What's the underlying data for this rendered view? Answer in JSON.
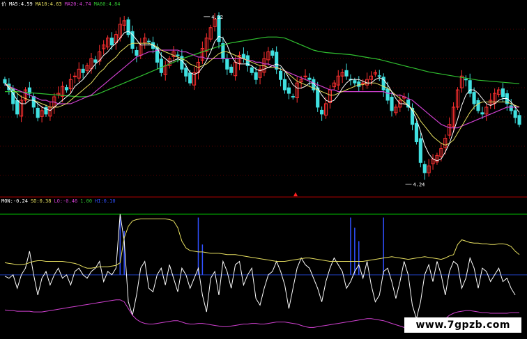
{
  "chart_data": [
    {
      "type": "candlestick",
      "legend": [
        {
          "text": "价",
          "color": "#ffffff"
        },
        {
          "text": "MA5:4.59",
          "color": "#ffffff"
        },
        {
          "text": "MA10:4.63",
          "color": "#e8e060"
        },
        {
          "text": "MA20:4.74",
          "color": "#d040d0"
        },
        {
          "text": "MA60:4.84",
          "color": "#30c030"
        }
      ],
      "price_range": [
        4.0,
        9.4
      ],
      "annotations": [
        {
          "text": "4.32",
          "price": 9.12,
          "bar": 50
        },
        {
          "text": "4.24",
          "price": 4.27,
          "bar": 99
        }
      ],
      "close": [
        7.2,
        7.0,
        6.6,
        6.3,
        6.7,
        7.0,
        6.9,
        6.5,
        6.2,
        6.4,
        6.3,
        6.5,
        6.8,
        6.9,
        7.1,
        7.0,
        7.3,
        7.4,
        7.6,
        7.5,
        7.7,
        7.9,
        7.8,
        8.1,
        8.3,
        8.5,
        8.3,
        8.6,
        8.9,
        9.0,
        8.6,
        8.2,
        8.0,
        8.3,
        8.5,
        8.4,
        8.2,
        7.8,
        7.5,
        7.7,
        7.9,
        8.1,
        8.0,
        7.6,
        7.4,
        7.2,
        7.5,
        7.8,
        8.2,
        8.5,
        8.8,
        9.05,
        8.4,
        7.9,
        7.6,
        7.5,
        7.8,
        8.0,
        7.9,
        7.7,
        7.5,
        7.3,
        7.6,
        7.9,
        8.1,
        8.0,
        7.6,
        7.3,
        7.0,
        6.9,
        6.8,
        7.2,
        7.3,
        7.4,
        7.3,
        7.0,
        6.5,
        6.3,
        6.6,
        7.0,
        7.2,
        7.4,
        7.5,
        7.4,
        7.3,
        7.2,
        7.1,
        7.2,
        7.3,
        7.4,
        7.5,
        7.4,
        7.0,
        6.7,
        6.4,
        6.5,
        6.7,
        6.8,
        6.5,
        6.0,
        5.5,
        4.9,
        4.6,
        4.8,
        5.0,
        5.1,
        5.3,
        5.6,
        6.0,
        6.5,
        7.0,
        7.4,
        7.3,
        6.9,
        6.6,
        6.4,
        6.3,
        6.5,
        6.7,
        6.9,
        7.0,
        6.8,
        6.6,
        6.4,
        6.2,
        6.0
      ],
      "ma5": [
        7.2,
        7.05,
        6.9,
        6.7,
        6.6,
        6.6,
        6.7,
        6.7,
        6.6,
        6.5,
        6.45,
        6.4,
        6.5,
        6.6,
        6.7,
        6.8,
        6.9,
        7.1,
        7.2,
        7.3,
        7.45,
        7.6,
        7.75,
        7.85,
        8.0,
        8.1,
        8.25,
        8.35,
        8.5,
        8.65,
        8.7,
        8.6,
        8.45,
        8.3,
        8.3,
        8.3,
        8.3,
        8.2,
        8.0,
        7.9,
        7.8,
        7.85,
        7.9,
        7.85,
        7.7,
        7.5,
        7.45,
        7.5,
        7.65,
        7.85,
        8.1,
        8.4,
        8.55,
        8.5,
        8.3,
        8.0,
        7.8,
        7.75,
        7.75,
        7.75,
        7.7,
        7.6,
        7.55,
        7.6,
        7.65,
        7.7,
        7.75,
        7.7,
        7.55,
        7.35,
        7.15,
        7.05,
        7.05,
        7.1,
        7.2,
        7.2,
        7.05,
        6.85,
        6.7,
        6.65,
        6.7,
        6.85,
        7.05,
        7.2,
        7.3,
        7.3,
        7.3,
        7.25,
        7.2,
        7.2,
        7.3,
        7.35,
        7.3,
        7.15,
        6.95,
        6.75,
        6.6,
        6.6,
        6.55,
        6.4,
        6.15,
        5.8,
        5.4,
        5.15,
        5.0,
        4.95,
        5.0,
        5.2,
        5.45,
        5.8,
        6.15,
        6.55,
        6.85,
        7.0,
        7.0,
        6.9,
        6.75,
        6.6,
        6.55,
        6.6,
        6.7,
        6.75,
        6.75,
        6.65,
        6.5,
        6.35
      ],
      "ma10": [
        7.2,
        7.1,
        7.0,
        6.9,
        6.8,
        6.75,
        6.7,
        6.7,
        6.65,
        6.6,
        6.55,
        6.5,
        6.5,
        6.5,
        6.55,
        6.6,
        6.7,
        6.8,
        6.9,
        7.0,
        7.1,
        7.2,
        7.35,
        7.5,
        7.6,
        7.75,
        7.85,
        7.95,
        8.1,
        8.2,
        8.3,
        8.35,
        8.35,
        8.35,
        8.35,
        8.35,
        8.3,
        8.25,
        8.15,
        8.1,
        8.05,
        8.0,
        7.95,
        7.9,
        7.85,
        7.75,
        7.7,
        7.65,
        7.7,
        7.75,
        7.85,
        7.95,
        8.05,
        8.1,
        8.1,
        8.05,
        8.0,
        7.95,
        7.9,
        7.85,
        7.8,
        7.75,
        7.7,
        7.7,
        7.65,
        7.65,
        7.65,
        7.6,
        7.55,
        7.45,
        7.35,
        7.25,
        7.2,
        7.15,
        7.1,
        7.05,
        7.0,
        6.95,
        6.9,
        6.85,
        6.85,
        6.9,
        6.95,
        7.0,
        7.05,
        7.1,
        7.15,
        7.15,
        7.2,
        7.2,
        7.2,
        7.15,
        7.1,
        7.05,
        6.95,
        6.85,
        6.75,
        6.65,
        6.55,
        6.45,
        6.3,
        6.1,
        5.95,
        5.8,
        5.65,
        5.55,
        5.45,
        5.4,
        5.45,
        5.55,
        5.75,
        5.95,
        6.15,
        6.35,
        6.5,
        6.6,
        6.65,
        6.65,
        6.65,
        6.65,
        6.65,
        6.65,
        6.65,
        6.6,
        6.55,
        6.5
      ],
      "ma20": [
        7.15,
        7.1,
        7.05,
        7.0,
        6.95,
        6.9,
        6.85,
        6.8,
        6.75,
        6.7,
        6.7,
        6.65,
        6.65,
        6.6,
        6.6,
        6.6,
        6.6,
        6.65,
        6.7,
        6.75,
        6.8,
        6.85,
        6.95,
        7.05,
        7.15,
        7.25,
        7.35,
        7.45,
        7.55,
        7.65,
        7.75,
        7.85,
        7.95,
        8.0,
        8.05,
        8.1,
        8.1,
        8.15,
        8.15,
        8.15,
        8.15,
        8.15,
        8.15,
        8.1,
        8.1,
        8.05,
        8.0,
        7.95,
        7.95,
        7.9,
        7.9,
        7.9,
        7.9,
        7.9,
        7.9,
        7.9,
        7.9,
        7.9,
        7.9,
        7.85,
        7.85,
        7.8,
        7.8,
        7.75,
        7.75,
        7.7,
        7.65,
        7.6,
        7.55,
        7.5,
        7.45,
        7.4,
        7.35,
        7.3,
        7.25,
        7.2,
        7.15,
        7.1,
        7.05,
        7.0,
        7.0,
        6.95,
        6.95,
        6.95,
        6.95,
        6.95,
        6.95,
        6.95,
        6.95,
        6.95,
        6.95,
        6.95,
        6.95,
        6.9,
        6.9,
        6.85,
        6.85,
        6.8,
        6.75,
        6.7,
        6.6,
        6.5,
        6.4,
        6.3,
        6.2,
        6.1,
        6.0,
        5.95,
        5.9,
        5.9,
        5.9,
        5.95,
        6.0,
        6.05,
        6.1,
        6.15,
        6.2,
        6.25,
        6.3,
        6.35,
        6.4,
        6.45,
        6.5,
        6.5,
        6.5,
        6.5
      ],
      "ma60": [
        6.95,
        6.95,
        6.95,
        6.95,
        6.94,
        6.93,
        6.92,
        6.91,
        6.9,
        6.89,
        6.88,
        6.87,
        6.86,
        6.85,
        6.84,
        6.83,
        6.82,
        6.81,
        6.8,
        6.8,
        6.81,
        6.83,
        6.86,
        6.9,
        6.95,
        7.0,
        7.05,
        7.1,
        7.15,
        7.2,
        7.25,
        7.3,
        7.35,
        7.4,
        7.45,
        7.5,
        7.55,
        7.6,
        7.65,
        7.7,
        7.75,
        7.8,
        7.85,
        7.9,
        7.94,
        7.98,
        8.02,
        8.06,
        8.1,
        8.14,
        8.18,
        8.22,
        8.26,
        8.3,
        8.33,
        8.36,
        8.38,
        8.4,
        8.42,
        8.44,
        8.46,
        8.48,
        8.5,
        8.52,
        8.53,
        8.53,
        8.53,
        8.52,
        8.5,
        8.45,
        8.4,
        8.35,
        8.3,
        8.25,
        8.2,
        8.15,
        8.12,
        8.1,
        8.08,
        8.07,
        8.06,
        8.05,
        8.04,
        8.03,
        8.02,
        8.0,
        7.98,
        7.96,
        7.94,
        7.92,
        7.9,
        7.88,
        7.85,
        7.82,
        7.79,
        7.76,
        7.73,
        7.7,
        7.67,
        7.64,
        7.61,
        7.58,
        7.55,
        7.52,
        7.5,
        7.48,
        7.46,
        7.44,
        7.42,
        7.4,
        7.38,
        7.36,
        7.34,
        7.32,
        7.3,
        7.28,
        7.27,
        7.26,
        7.25,
        7.24,
        7.23,
        7.22,
        7.21,
        7.2,
        7.19,
        7.18
      ]
    },
    {
      "type": "line",
      "legend": [
        {
          "text": "MON:-0.24",
          "color": "#ffffff"
        },
        {
          "text": "SO:0.38",
          "color": "#e8e060"
        },
        {
          "text": "LO:-0.46",
          "color": "#d040d0"
        },
        {
          "text": "1.00",
          "color": "#30c030"
        },
        {
          "text": "HI:0.10",
          "color": "#3050ff"
        }
      ],
      "y_range": [
        -0.8,
        1.1
      ],
      "hline": 1.0,
      "hi_level": 0.1,
      "series": [
        {
          "key": "MON",
          "values": [
            0.08,
            0.05,
            0.1,
            -0.1,
            0.1,
            0.2,
            0.45,
            0.1,
            -0.2,
            0.05,
            0.15,
            -0.05,
            0.1,
            0.2,
            0.05,
            0.1,
            -0.05,
            0.15,
            0.2,
            0.1,
            0.05,
            0.15,
            0.2,
            0.3,
            0.0,
            0.15,
            0.1,
            0.2,
            1.0,
            0.6,
            -0.3,
            -0.5,
            -0.2,
            0.2,
            0.3,
            -0.1,
            -0.15,
            0.1,
            0.2,
            -0.05,
            0.25,
            0.05,
            -0.15,
            0.2,
            0.1,
            -0.1,
            0.05,
            0.2,
            -0.2,
            -0.45,
            0.05,
            0.15,
            -0.2,
            0.3,
            0.15,
            -0.1,
            0.25,
            0.3,
            -0.05,
            0.1,
            0.2,
            -0.25,
            -0.35,
            -0.1,
            0.1,
            0.15,
            0.3,
            0.15,
            -0.05,
            -0.4,
            -0.1,
            0.2,
            0.35,
            0.25,
            0.2,
            0.05,
            -0.1,
            -0.3,
            0.0,
            0.2,
            0.35,
            0.25,
            0.15,
            -0.1,
            0.0,
            0.15,
            0.25,
            0.05,
            0.3,
            -0.05,
            -0.3,
            -0.2,
            0.15,
            0.2,
            0.0,
            -0.25,
            0.0,
            0.3,
            0.1,
            -0.35,
            -0.55,
            -0.3,
            0.1,
            0.25,
            0.0,
            0.3,
            0.1,
            -0.2,
            0.15,
            0.3,
            0.25,
            -0.1,
            0.05,
            0.35,
            0.2,
            -0.1,
            0.2,
            0.15,
            0.0,
            0.1,
            0.2,
            0.0,
            0.05,
            -0.1,
            -0.2
          ]
        },
        {
          "key": "SO",
          "values": [
            0.28,
            0.27,
            0.26,
            0.25,
            0.25,
            0.26,
            0.28,
            0.3,
            0.31,
            0.31,
            0.3,
            0.3,
            0.3,
            0.3,
            0.3,
            0.29,
            0.28,
            0.27,
            0.25,
            0.22,
            0.2,
            0.2,
            0.21,
            0.22,
            0.22,
            0.22,
            0.23,
            0.24,
            0.28,
            0.65,
            0.82,
            0.9,
            0.92,
            0.93,
            0.93,
            0.93,
            0.93,
            0.93,
            0.93,
            0.93,
            0.92,
            0.9,
            0.8,
            0.6,
            0.5,
            0.46,
            0.45,
            0.44,
            0.44,
            0.43,
            0.42,
            0.42,
            0.42,
            0.41,
            0.4,
            0.4,
            0.4,
            0.39,
            0.38,
            0.37,
            0.36,
            0.35,
            0.34,
            0.33,
            0.32,
            0.31,
            0.3,
            0.3,
            0.3,
            0.31,
            0.32,
            0.33,
            0.34,
            0.35,
            0.35,
            0.34,
            0.33,
            0.32,
            0.31,
            0.3,
            0.3,
            0.3,
            0.3,
            0.3,
            0.3,
            0.3,
            0.3,
            0.3,
            0.31,
            0.32,
            0.33,
            0.34,
            0.35,
            0.36,
            0.37,
            0.36,
            0.35,
            0.34,
            0.33,
            0.34,
            0.35,
            0.36,
            0.37,
            0.36,
            0.35,
            0.34,
            0.33,
            0.35,
            0.38,
            0.4,
            0.55,
            0.62,
            0.6,
            0.58,
            0.57,
            0.57,
            0.56,
            0.56,
            0.55,
            0.55,
            0.56,
            0.56,
            0.55,
            0.52,
            0.45,
            0.4
          ]
        },
        {
          "key": "LO",
          "values": [
            -0.42,
            -0.43,
            -0.43,
            -0.44,
            -0.44,
            -0.44,
            -0.44,
            -0.45,
            -0.45,
            -0.45,
            -0.44,
            -0.43,
            -0.42,
            -0.41,
            -0.4,
            -0.39,
            -0.38,
            -0.37,
            -0.36,
            -0.35,
            -0.34,
            -0.33,
            -0.32,
            -0.31,
            -0.3,
            -0.29,
            -0.28,
            -0.27,
            -0.27,
            -0.3,
            -0.4,
            -0.5,
            -0.56,
            -0.6,
            -0.62,
            -0.63,
            -0.63,
            -0.62,
            -0.61,
            -0.6,
            -0.59,
            -0.58,
            -0.58,
            -0.6,
            -0.62,
            -0.63,
            -0.63,
            -0.62,
            -0.62,
            -0.63,
            -0.64,
            -0.65,
            -0.66,
            -0.67,
            -0.67,
            -0.66,
            -0.65,
            -0.64,
            -0.63,
            -0.63,
            -0.62,
            -0.62,
            -0.63,
            -0.63,
            -0.62,
            -0.61,
            -0.6,
            -0.6,
            -0.6,
            -0.61,
            -0.62,
            -0.63,
            -0.65,
            -0.67,
            -0.68,
            -0.68,
            -0.67,
            -0.66,
            -0.65,
            -0.64,
            -0.63,
            -0.62,
            -0.61,
            -0.6,
            -0.59,
            -0.58,
            -0.57,
            -0.56,
            -0.55,
            -0.55,
            -0.56,
            -0.57,
            -0.58,
            -0.6,
            -0.62,
            -0.64,
            -0.66,
            -0.68,
            -0.7,
            -0.72,
            -0.74,
            -0.75,
            -0.74,
            -0.72,
            -0.7,
            -0.65,
            -0.6,
            -0.55,
            -0.5,
            -0.47,
            -0.45,
            -0.44,
            -0.43,
            -0.43,
            -0.44,
            -0.45,
            -0.46,
            -0.46,
            -0.47,
            -0.47,
            -0.47,
            -0.47,
            -0.47,
            -0.46,
            -0.46,
            -0.46
          ]
        }
      ],
      "spikes": [
        {
          "bar": 28,
          "value": 0.95
        },
        {
          "bar": 29,
          "value": 0.75
        },
        {
          "bar": 47,
          "value": 0.95
        },
        {
          "bar": 48,
          "value": 0.55
        },
        {
          "bar": 84,
          "value": 0.95
        },
        {
          "bar": 85,
          "value": 0.8
        },
        {
          "bar": 86,
          "value": 0.6
        },
        {
          "bar": 92,
          "value": 0.95
        }
      ]
    }
  ],
  "colors": {
    "up": "#ff3030",
    "down": "#40e0e0",
    "grid": "#5a0000",
    "divider": "#b00000",
    "hline": "#00a000",
    "spike": "#3050ff",
    "hi_line": "#2040c0"
  },
  "watermark": "www.7gpzb.com"
}
